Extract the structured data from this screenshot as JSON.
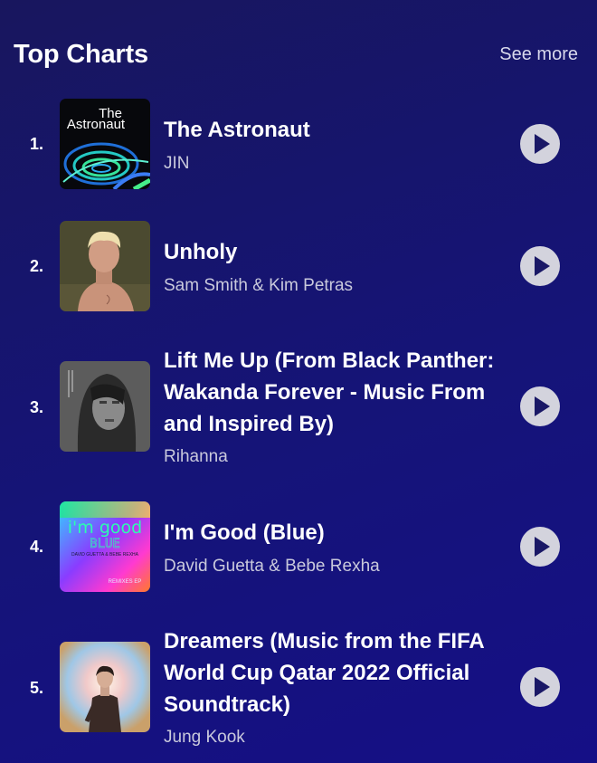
{
  "header": {
    "title": "Top Charts",
    "see_more": "See more"
  },
  "tracks": [
    {
      "rank": "1.",
      "title": "The Astronaut",
      "artist": "JIN",
      "cover_text": [
        "The",
        "Astronaut"
      ]
    },
    {
      "rank": "2.",
      "title": "Unholy",
      "artist": "Sam Smith & Kim Petras"
    },
    {
      "rank": "3.",
      "title": "Lift Me Up (From Black Panther: Wakanda Forever - Music From and Inspired By)",
      "artist": "Rihanna"
    },
    {
      "rank": "4.",
      "title": "I'm Good (Blue)",
      "artist": "David Guetta & Bebe Rexha",
      "cover_text": [
        "i'm good",
        "BLUE",
        "DAVID GUETTA & BEBE REXHA",
        "REMIXES EP"
      ]
    },
    {
      "rank": "5.",
      "title": "Dreamers (Music from the FIFA World Cup Qatar 2022 Official Soundtrack)",
      "artist": "Jung Kook"
    }
  ],
  "icons": {
    "play": "play-icon"
  },
  "colors": {
    "background": "#16137a",
    "play_button": "#d3d3dd",
    "artist_text": "#c9c9dc"
  }
}
